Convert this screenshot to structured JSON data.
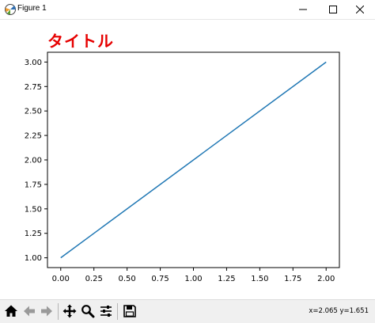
{
  "window": {
    "title": "Figure 1",
    "app_icon": "matplotlib-icon",
    "controls": [
      "minimize-icon",
      "maximize-icon",
      "close-icon"
    ]
  },
  "chart_data": {
    "type": "line",
    "title": "タイトル",
    "title_color": "#e60000",
    "xlabel": "",
    "ylabel": "",
    "x": [
      0.0,
      2.0
    ],
    "series": [
      {
        "values": [
          1.0,
          3.0
        ],
        "color": "#1f77b4"
      }
    ],
    "xlim": [
      -0.1,
      2.1
    ],
    "ylim": [
      0.9,
      3.1
    ],
    "xticks": [
      0.0,
      0.25,
      0.5,
      0.75,
      1.0,
      1.25,
      1.5,
      1.75,
      2.0
    ],
    "xtick_labels": [
      "0.00",
      "0.25",
      "0.50",
      "0.75",
      "1.00",
      "1.25",
      "1.50",
      "1.75",
      "2.00"
    ],
    "yticks": [
      1.0,
      1.25,
      1.5,
      1.75,
      2.0,
      2.25,
      2.5,
      2.75,
      3.0
    ],
    "ytick_labels": [
      "1.00",
      "1.25",
      "1.50",
      "1.75",
      "2.00",
      "2.25",
      "2.50",
      "2.75",
      "3.00"
    ],
    "grid": false,
    "legend": "none"
  },
  "toolbar": {
    "buttons": [
      "home-icon",
      "back-icon",
      "forward-icon",
      "pan-icon",
      "zoom-icon",
      "configure-icon",
      "save-icon"
    ],
    "coords_text": "x=2.065 y=1.651"
  }
}
